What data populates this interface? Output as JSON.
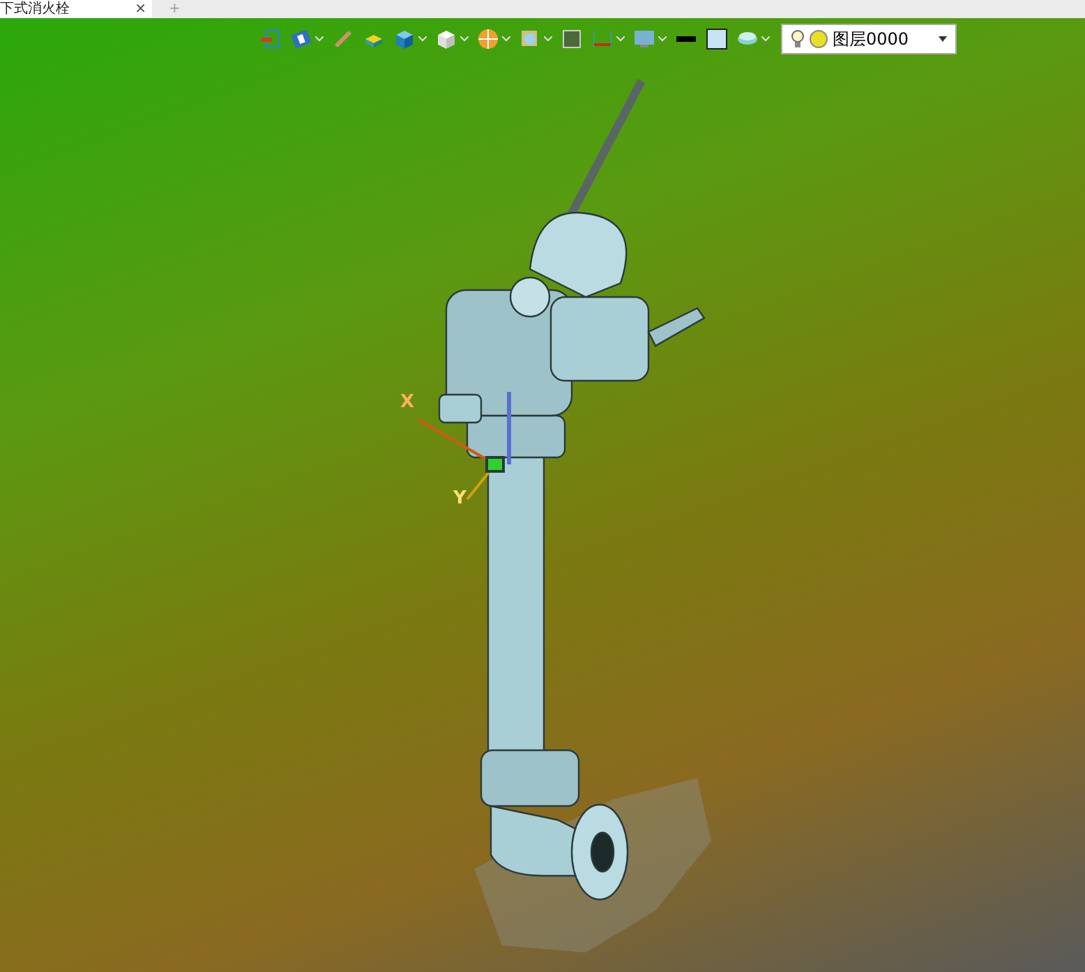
{
  "tabs": [
    {
      "title": "下式消火栓",
      "close": "×",
      "selected": true
    }
  ],
  "new_tab": "+",
  "layer_selector": {
    "value": "图层0000"
  },
  "axis_labels": [
    "X",
    "Y"
  ]
}
